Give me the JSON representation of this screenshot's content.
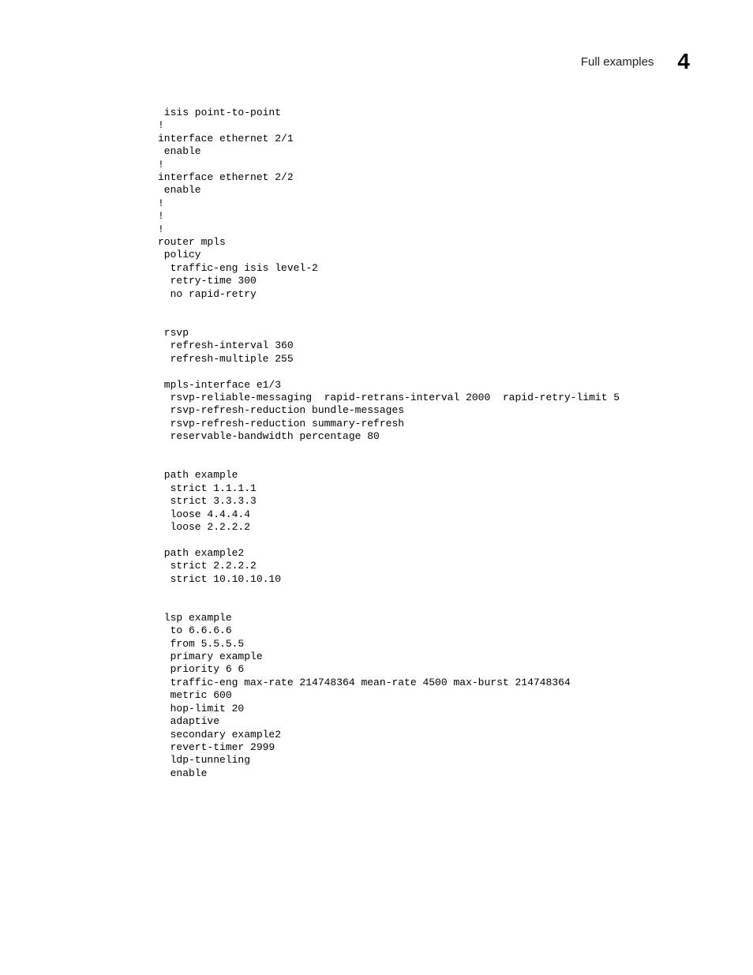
{
  "header": {
    "title": "Full examples",
    "chapter": "4"
  },
  "code": " isis point-to-point\n!\ninterface ethernet 2/1\n enable\n!\ninterface ethernet 2/2\n enable\n!\n!\n!\nrouter mpls\n policy\n  traffic-eng isis level-2\n  retry-time 300\n  no rapid-retry\n\n\n rsvp\n  refresh-interval 360\n  refresh-multiple 255\n\n mpls-interface e1/3\n  rsvp-reliable-messaging  rapid-retrans-interval 2000  rapid-retry-limit 5\n  rsvp-refresh-reduction bundle-messages\n  rsvp-refresh-reduction summary-refresh\n  reservable-bandwidth percentage 80\n\n\n path example\n  strict 1.1.1.1\n  strict 3.3.3.3\n  loose 4.4.4.4\n  loose 2.2.2.2\n\n path example2\n  strict 2.2.2.2\n  strict 10.10.10.10\n\n\n lsp example\n  to 6.6.6.6\n  from 5.5.5.5\n  primary example\n  priority 6 6\n  traffic-eng max-rate 214748364 mean-rate 4500 max-burst 214748364\n  metric 600\n  hop-limit 20\n  adaptive\n  secondary example2\n  revert-timer 2999\n  ldp-tunneling\n  enable"
}
